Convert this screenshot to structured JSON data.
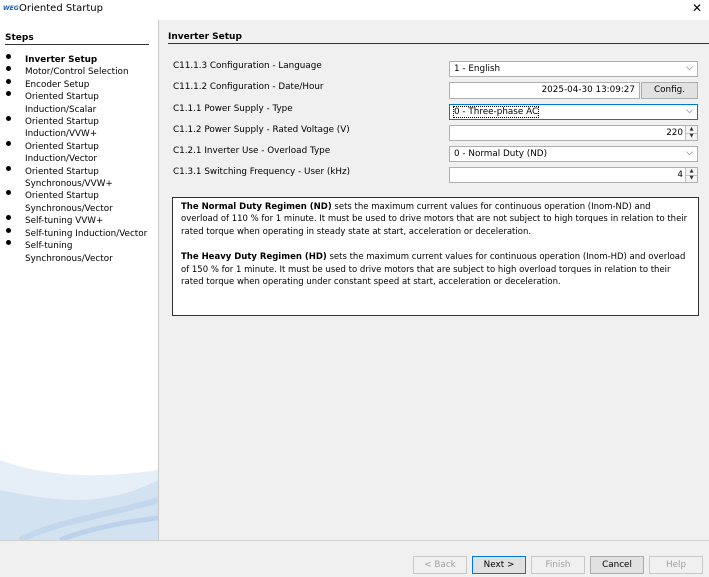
{
  "window": {
    "logo_text": "WEG",
    "title": "Oriented Startup",
    "close_glyph": "✕"
  },
  "sidebar": {
    "heading": "Steps",
    "steps": [
      {
        "label": "Inverter Setup",
        "active": true
      },
      {
        "label": "Motor/Control Selection",
        "active": false
      },
      {
        "label": "Encoder Setup",
        "active": false
      },
      {
        "label": "Oriented Startup Induction/Scalar",
        "active": false
      },
      {
        "label": "Oriented Startup Induction/VVW+",
        "active": false
      },
      {
        "label": "Oriented Startup Induction/Vector",
        "active": false
      },
      {
        "label": "Oriented Startup Synchronous/VVW+",
        "active": false
      },
      {
        "label": "Oriented Startup Synchronous/Vector",
        "active": false
      },
      {
        "label": "Self-tuning VVW+",
        "active": false
      },
      {
        "label": "Self-tuning Induction/Vector",
        "active": false
      },
      {
        "label": "Self-tuning Synchronous/Vector",
        "active": false
      }
    ]
  },
  "main": {
    "title": "Inverter Setup",
    "params": {
      "language": {
        "label": "C11.1.3 Configuration - Language",
        "value": "1 - English"
      },
      "datetime": {
        "label": "C11.1.2 Configuration - Date/Hour",
        "value": "2025-04-30 13:09:27",
        "button": "Config."
      },
      "supply_type": {
        "label": "C1.1.1 Power Supply - Type",
        "value": "0 - Three-phase AC"
      },
      "voltage": {
        "label": "C1.1.2 Power Supply - Rated Voltage (V)",
        "value": "220"
      },
      "overload": {
        "label": "C1.2.1 Inverter Use - Overload Type",
        "value": "0 - Normal Duty (ND)"
      },
      "frequency": {
        "label": "C1.3.1 Switching Frequency - User (kHz)",
        "value": "4"
      }
    },
    "info": {
      "nd_title": "The Normal Duty Regimen (ND)",
      "nd_text": " sets the maximum current values for continuous operation (Inom-ND) and overload of 110 % for 1 minute. It must be used to drive motors that are not subject to high torques in relation to their rated torque when operating in steady state at start, acceleration or deceleration.",
      "hd_title": "The Heavy Duty Regimen (HD)",
      "hd_text": " sets the maximum current values for continuous operation (Inom-HD) and overload of 150 % for 1 minute. It must be used to drive motors that are subject to high overload torques in relation to their rated torque when operating under constant speed at start, acceleration or deceleration."
    }
  },
  "footer": {
    "back": "< Back",
    "next": "Next >",
    "finish": "Finish",
    "cancel": "Cancel",
    "help": "Help"
  },
  "icons": {
    "dropdown": "chevron-down-icon",
    "spin_up": "spin-up-icon",
    "spin_down": "spin-down-icon"
  }
}
